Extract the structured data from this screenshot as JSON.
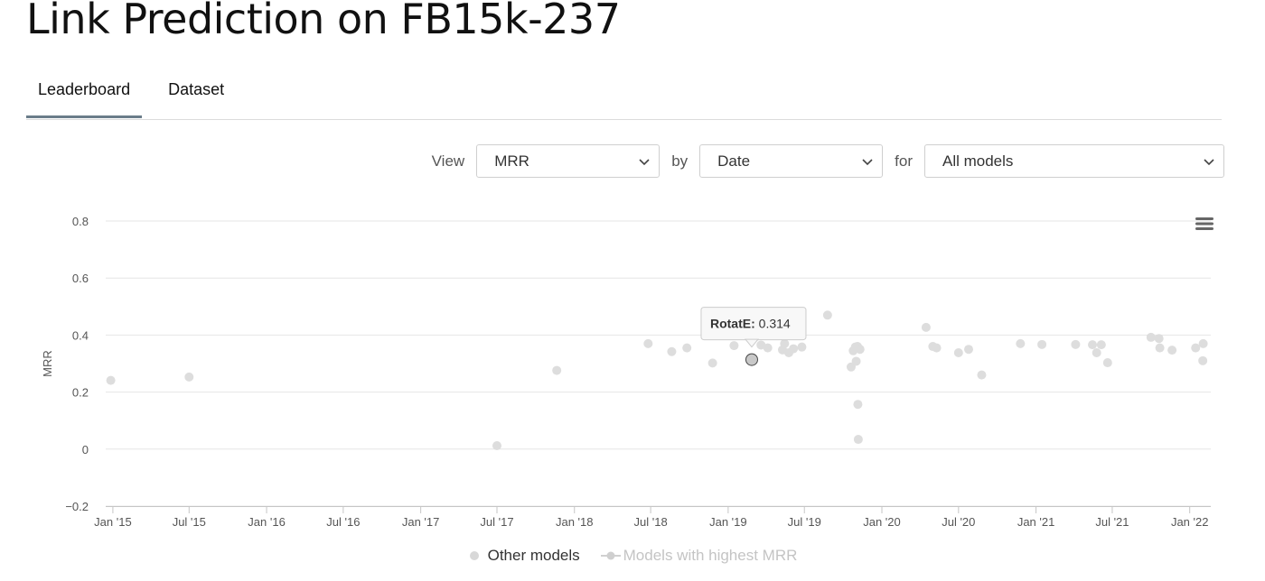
{
  "page": {
    "title": "Link Prediction on FB15k-237"
  },
  "tabs": [
    {
      "label": "Leaderboard",
      "active": true
    },
    {
      "label": "Dataset",
      "active": false
    }
  ],
  "controls": {
    "view_label": "View",
    "view_value": "MRR",
    "by_label": "by",
    "by_value": "Date",
    "for_label": "for",
    "for_value": "All models"
  },
  "colors": {
    "other_point": "#dddddd",
    "highlight_point": "#c8c8c8",
    "grid": "#e6e6e6"
  },
  "chart_data": {
    "type": "scatter",
    "xlabel": "",
    "ylabel": "MRR",
    "ylim": [
      -0.2,
      0.8
    ],
    "yticks": [
      -0.2,
      0,
      0.2,
      0.4,
      0.6,
      0.8
    ],
    "ytick_labels": [
      "−0.2",
      "0",
      "0.2",
      "0.4",
      "0.6",
      "0.8"
    ],
    "xlim": [
      "2014-12-15",
      "2022-02-20"
    ],
    "xticks": [
      {
        "date": "2015-01-01",
        "label": "Jan '15"
      },
      {
        "date": "2015-07-01",
        "label": "Jul '15"
      },
      {
        "date": "2016-01-01",
        "label": "Jan '16"
      },
      {
        "date": "2016-07-01",
        "label": "Jul '16"
      },
      {
        "date": "2017-01-01",
        "label": "Jan '17"
      },
      {
        "date": "2017-07-01",
        "label": "Jul '17"
      },
      {
        "date": "2018-01-01",
        "label": "Jan '18"
      },
      {
        "date": "2018-07-01",
        "label": "Jul '18"
      },
      {
        "date": "2019-01-01",
        "label": "Jan '19"
      },
      {
        "date": "2019-07-01",
        "label": "Jul '19"
      },
      {
        "date": "2020-01-01",
        "label": "Jan '20"
      },
      {
        "date": "2020-07-01",
        "label": "Jul '20"
      },
      {
        "date": "2021-01-01",
        "label": "Jan '21"
      },
      {
        "date": "2021-07-01",
        "label": "Jul '21"
      },
      {
        "date": "2022-01-01",
        "label": "Jan '22"
      }
    ],
    "grid": true,
    "legend_position": "bottom",
    "series": [
      {
        "name": "Other models",
        "visible": true,
        "points": [
          [
            "2014-12-27",
            0.241
          ],
          [
            "2015-07-01",
            0.253
          ],
          [
            "2017-07-01",
            0.012
          ],
          [
            "2017-11-20",
            0.276
          ],
          [
            "2018-06-25",
            0.37
          ],
          [
            "2018-08-20",
            0.342
          ],
          [
            "2018-09-25",
            0.355
          ],
          [
            "2018-11-25",
            0.302
          ],
          [
            "2019-01-15",
            0.363
          ],
          [
            "2019-03-20",
            0.365
          ],
          [
            "2019-04-05",
            0.355
          ],
          [
            "2019-05-10",
            0.348
          ],
          [
            "2019-05-15",
            0.37
          ],
          [
            "2019-05-25",
            0.338
          ],
          [
            "2019-06-05",
            0.352
          ],
          [
            "2019-06-25",
            0.358
          ],
          [
            "2019-08-25",
            0.47
          ],
          [
            "2019-10-20",
            0.288
          ],
          [
            "2019-10-25",
            0.345
          ],
          [
            "2019-10-30",
            0.358
          ],
          [
            "2019-11-01",
            0.308
          ],
          [
            "2019-11-04",
            0.36
          ],
          [
            "2019-11-05",
            0.157
          ],
          [
            "2019-11-06",
            0.034
          ],
          [
            "2019-11-10",
            0.35
          ],
          [
            "2020-04-15",
            0.427
          ],
          [
            "2020-05-01",
            0.36
          ],
          [
            "2020-05-10",
            0.355
          ],
          [
            "2020-07-01",
            0.338
          ],
          [
            "2020-07-25",
            0.35
          ],
          [
            "2020-08-25",
            0.26
          ],
          [
            "2020-11-25",
            0.37
          ],
          [
            "2021-01-15",
            0.367
          ],
          [
            "2021-04-05",
            0.367
          ],
          [
            "2021-05-15",
            0.366
          ],
          [
            "2021-05-25",
            0.338
          ],
          [
            "2021-06-05",
            0.366
          ],
          [
            "2021-06-20",
            0.303
          ],
          [
            "2021-10-01",
            0.392
          ],
          [
            "2021-10-20",
            0.388
          ],
          [
            "2021-10-22",
            0.355
          ],
          [
            "2021-11-20",
            0.347
          ],
          [
            "2022-01-15",
            0.355
          ],
          [
            "2022-02-01",
            0.31
          ],
          [
            "2022-02-02",
            0.37
          ]
        ]
      },
      {
        "name": "Models with highest MRR",
        "visible": false,
        "points": [
          [
            "2019-02-26",
            0.314
          ]
        ]
      }
    ],
    "tooltip": {
      "model": "RotatE",
      "sep": ": ",
      "value": "0.314",
      "date": "2019-02-26",
      "y": 0.314
    }
  },
  "chart_menu": {
    "icon": "hamburger-menu-icon"
  }
}
